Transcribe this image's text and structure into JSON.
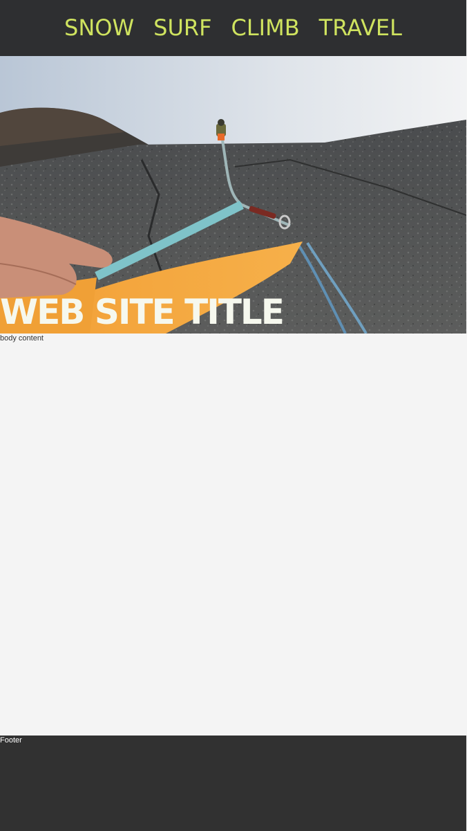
{
  "nav": {
    "items": [
      {
        "label": "SNOW"
      },
      {
        "label": "SURF"
      },
      {
        "label": "CLIMB"
      },
      {
        "label": "TRAVEL"
      }
    ]
  },
  "hero": {
    "title": "WEB SITE TITLE"
  },
  "main": {
    "text": "body content"
  },
  "footer": {
    "text": "Footer"
  },
  "colors": {
    "nav_bg": "#2e2f31",
    "nav_link": "#cfe35f",
    "page_bg": "#f4f4f4",
    "footer_bg": "#313131"
  }
}
